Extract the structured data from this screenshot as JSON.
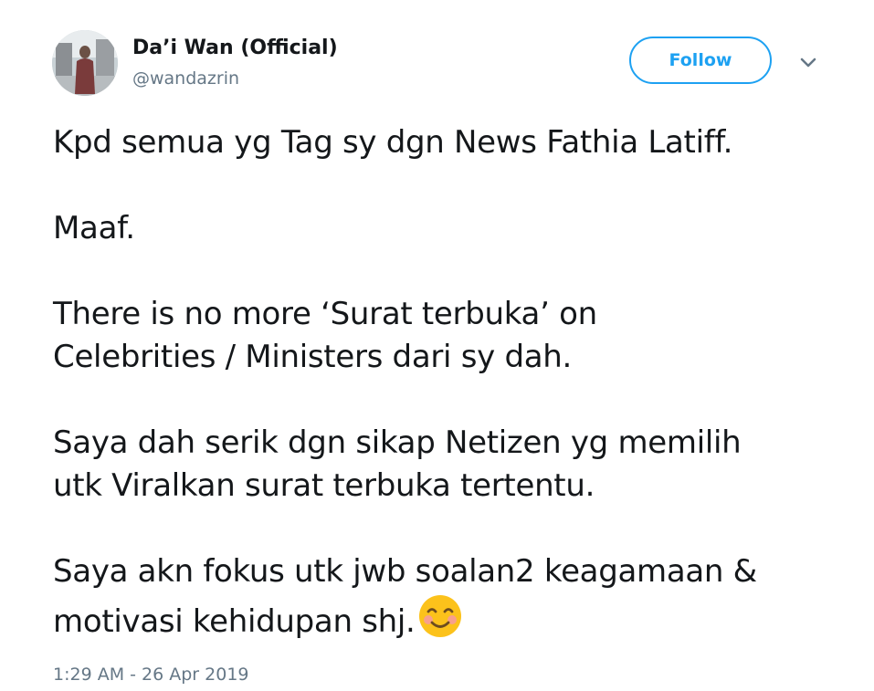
{
  "author": {
    "display_name": "Da’i Wan (Official)",
    "handle": "@wandazrin",
    "avatar_icon": "avatar-photo"
  },
  "actions": {
    "follow_label": "Follow",
    "menu_icon": "chevron-down-icon"
  },
  "tweet": {
    "paragraphs": [
      [
        "Kpd semua yg Tag sy dgn News Fathia Latiff."
      ],
      [
        "Maaf."
      ],
      [
        "There is no more ‘Surat terbuka’ on",
        "Celebrities / Ministers dari sy dah."
      ],
      [
        "Saya dah serik dgn sikap Netizen yg memilih",
        "utk Viralkan surat terbuka tertentu."
      ],
      [
        "Saya akn fokus utk jwb soalan2 keagamaan &",
        "motivasi kehidupan shj."
      ]
    ],
    "emoji": "smiling-face-with-smiling-eyes",
    "timestamp": "1:29 AM - 26 Apr 2019"
  },
  "colors": {
    "accent": "#1da1f2",
    "text": "#14171a",
    "muted": "#657786"
  }
}
